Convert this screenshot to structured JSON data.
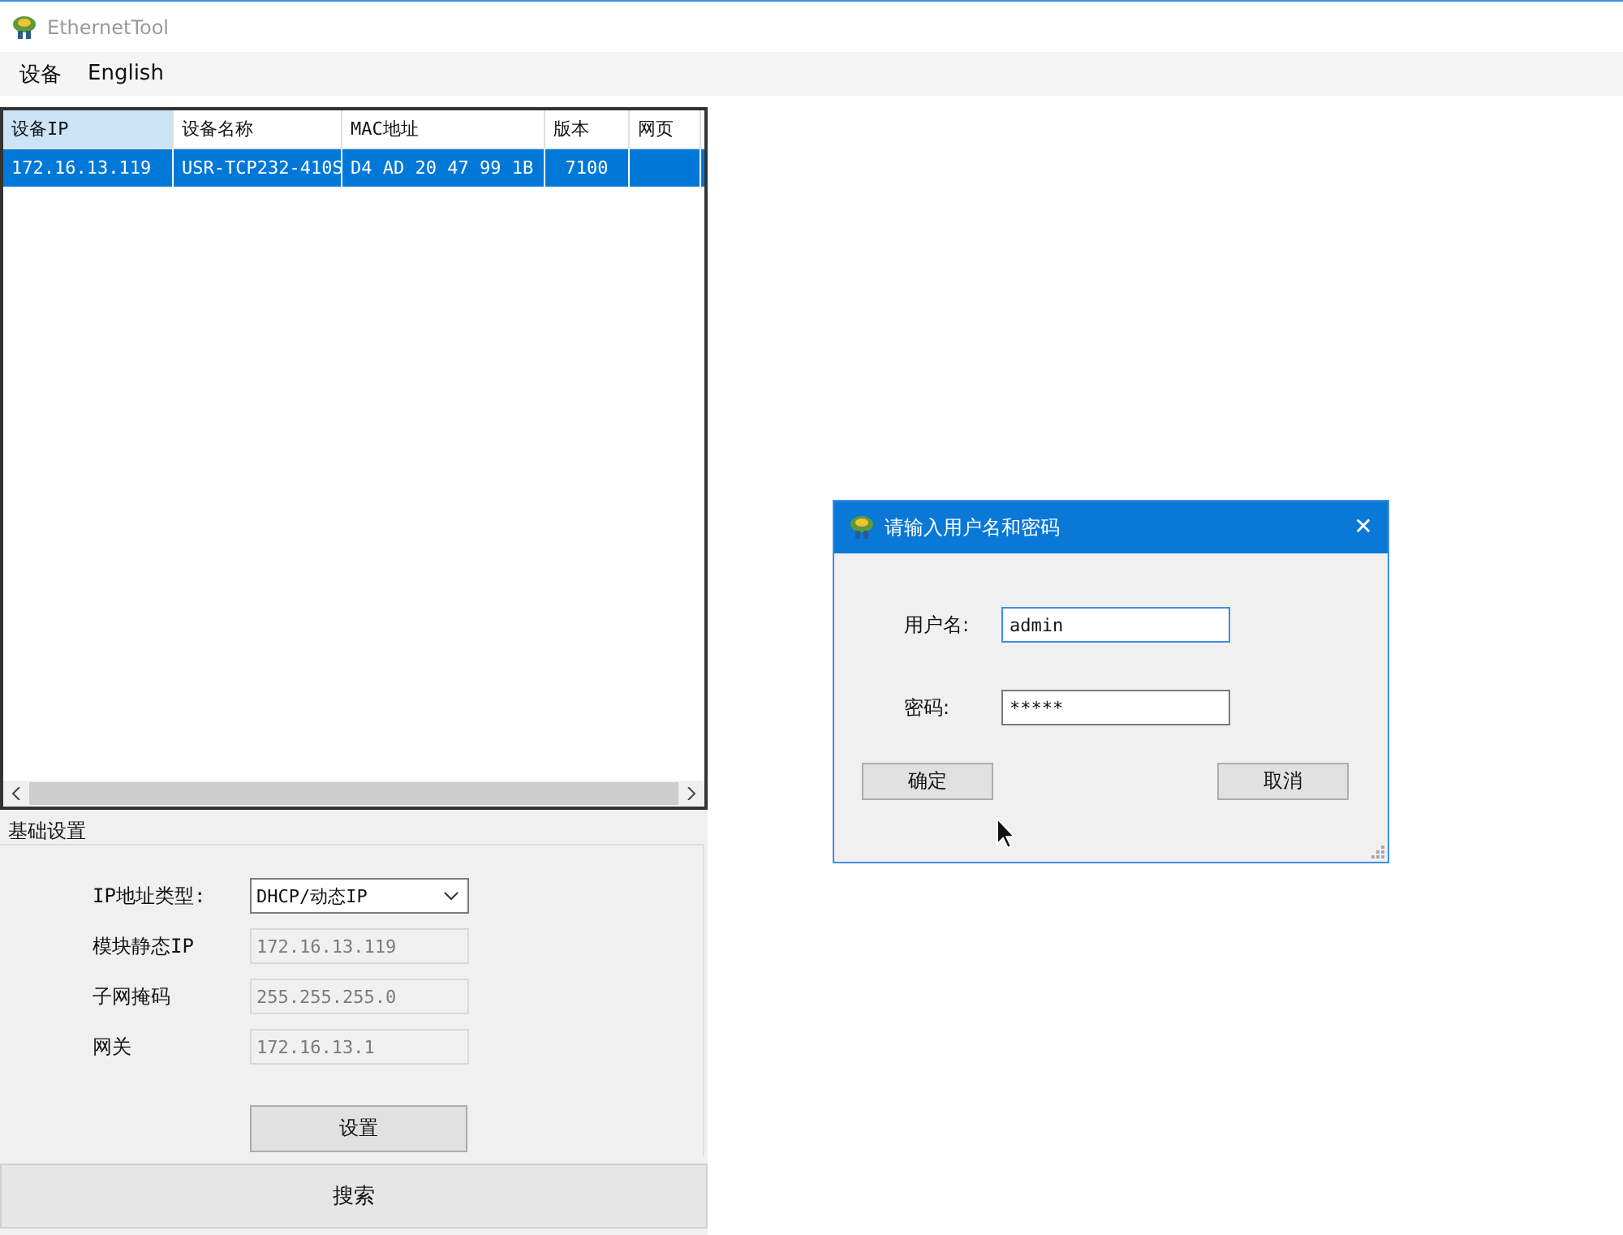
{
  "window": {
    "title": "EthernetTool"
  },
  "menu": [
    {
      "label": "设备"
    },
    {
      "label": "English"
    }
  ],
  "table": {
    "columns": [
      {
        "label": "设备IP",
        "highlighted": true
      },
      {
        "label": "设备名称",
        "highlighted": false
      },
      {
        "label": "MAC地址",
        "highlighted": false
      },
      {
        "label": "版本",
        "highlighted": false
      },
      {
        "label": "网页",
        "highlighted": false
      }
    ],
    "rows": [
      {
        "selected": true,
        "cells": [
          "172.16.13.119",
          "USR-TCP232-410S",
          "D4 AD 20 47 99 1B",
          "7100",
          ""
        ]
      }
    ]
  },
  "settings": {
    "title": "基础设置",
    "fields": [
      {
        "kind": "dropdown",
        "label": "IP地址类型:",
        "value": "DHCP/动态IP",
        "disabled": false
      },
      {
        "kind": "text",
        "label": "模块静态IP",
        "value": "172.16.13.119",
        "disabled": true
      },
      {
        "kind": "text",
        "label": "子网掩码",
        "value": "255.255.255.0",
        "disabled": true
      },
      {
        "kind": "text",
        "label": "网关",
        "value": "172.16.13.1",
        "disabled": true
      }
    ],
    "button": "设置"
  },
  "search_button": "搜索",
  "dialog": {
    "title": "请输入用户名和密码",
    "close": "✕",
    "fields": [
      {
        "label": "用户名:",
        "value": "admin",
        "focused": true
      },
      {
        "label": "密码:",
        "value": "*****",
        "focused": false
      }
    ],
    "buttons": [
      "确定",
      "取消"
    ]
  }
}
